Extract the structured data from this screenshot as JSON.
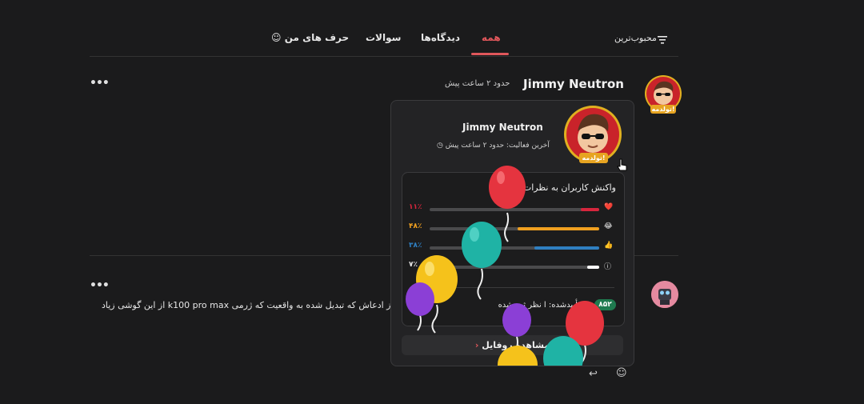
{
  "tabs": {
    "my_words": "حرف های من",
    "questions": "سوالات",
    "opinions": "دیدگاه‌ها",
    "all": "همه",
    "sort": "محبوب‌ترین"
  },
  "comment1": {
    "name": "Jimmy Neutron",
    "time": "حدود ۲ ساعت پیش",
    "more": "•••",
    "birthday_badge": "تولدمه!"
  },
  "comment2": {
    "more": "•••",
    "text": "م از ادعاش که تبدیل شده به واقعیت که ژرمی k100 pro max از این گوشی زیاد"
  },
  "popup": {
    "name": "Jimmy Neutron",
    "last_active": "آخرین فعالیت: حدود ۲ ساعت پیش",
    "birthday_badge": "تولدمه!",
    "reactions_title": "واکنش کاربران به نظرات ای",
    "reactions": [
      {
        "emoji": "❤️",
        "percent_label": "۱۱٪",
        "value": 11,
        "color": "#d7263d"
      },
      {
        "emoji": "😂",
        "percent_label": "۴۸٪",
        "value": 48,
        "color": "#f0a020"
      },
      {
        "emoji": "👍",
        "percent_label": "۳۸٪",
        "value": 38,
        "color": "#2f7fc1"
      },
      {
        "emoji": "ⓘ",
        "percent_label": "۷٪",
        "value": 7,
        "color": "#ffffff"
      }
    ],
    "approved_label": "ی تأییدشده: ا نظر ثبت‌شده",
    "approved_count": "۸۵۲",
    "profile_button": "مشاهده روفایل"
  },
  "icons": {
    "sort": "sort-lines-icon",
    "smile": "smile-icon",
    "reply": "reply-icon",
    "clock": "clock-icon",
    "pointer": "hand-pointer-icon",
    "arrow": "chevron-left-icon"
  }
}
